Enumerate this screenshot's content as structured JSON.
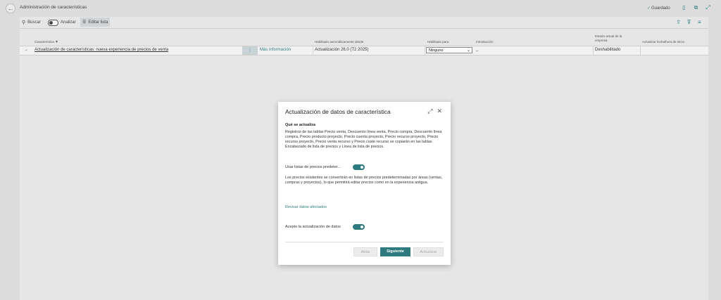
{
  "header": {
    "title": "Administración de características",
    "saved_label": "Guardado"
  },
  "toolbar": {
    "search_label": "Buscar",
    "analyze_label": "Analizar",
    "edit_list_label": "Editar lista"
  },
  "table": {
    "columns": {
      "feature": "Característica",
      "enabled_from": "Habilitado automáticamente desde",
      "enabled_for": "Habilitado para",
      "intro": "Introducción",
      "state_line1": "Estado actual de la",
      "state_line2": "empresa",
      "update_date": "Actualizar fecha/hora de inicio"
    },
    "row": {
      "arrow": "→",
      "feature": "Actualización de características: nueva experiencia de precios de venta",
      "more_info": "Más información",
      "enabled_from": "Actualización 26.0 (T2 2025)",
      "enabled_for": "Ninguno",
      "intro": "_",
      "state": "Deshabilitado",
      "update_date": ""
    }
  },
  "dialog": {
    "title": "Actualización de datos de característica",
    "section_title": "Qué se actualiza",
    "description": "Registros de las tablas Precio venta, Descuento línea venta, Precio compra, Descuento línea compra, Precio producto proyecto, Precio cuenta proyecto, Precio recurso proyecto, Precio recurso proyecto, Precio venta recurso y Precio coste recurso se copiarán en las tablas Encabezado de lista de precios y Línea de lista de precios.",
    "use_default_label": "Usar listas de precios predeter...",
    "use_default_on": true,
    "use_default_note": "Los precios existentes se convertirán en listas de precios predeterminadas por áreas (ventas, compras y proyectos), lo que permitirá editar precios como en la experiencia antigua.",
    "review_link": "Revisar datos afectados",
    "accept_label": "Acepto la actualización de datos",
    "accept_on": true,
    "buttons": {
      "back": "Atrás",
      "next": "Siguiente",
      "update": "Actualizar"
    }
  },
  "colors": {
    "accent": "#2e7a7e",
    "overlay_bg": "#dcdcdc"
  }
}
